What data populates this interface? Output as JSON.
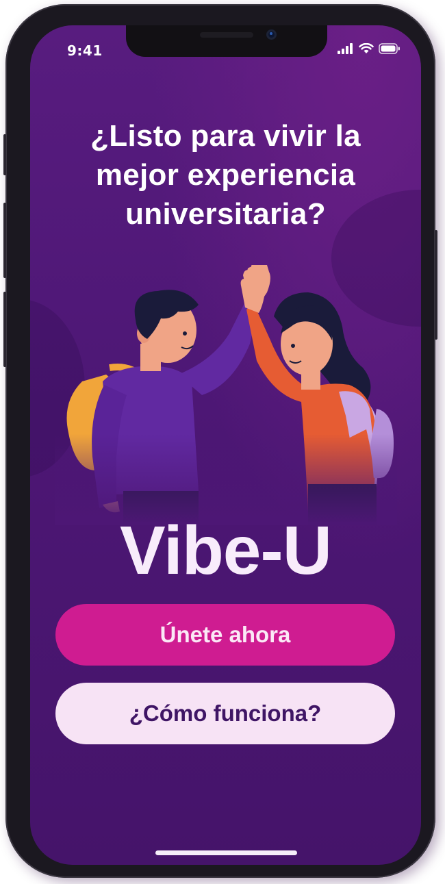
{
  "status_bar": {
    "time": "9:41",
    "icons": [
      "signal-icon",
      "wifi-icon",
      "battery-icon"
    ]
  },
  "onboarding": {
    "title": "¿Listo para vivir la mejor experiencia universitaria?",
    "illustration": "two-students-high-five",
    "brand": "Vibe-U",
    "primary_button": "Únete ahora",
    "secondary_button": "¿Cómo funciona?"
  },
  "colors": {
    "background": "#4d1775",
    "primary_button": "#cf1c91",
    "secondary_button": "#f7e3f5",
    "secondary_button_text": "#3f1565",
    "text": "#ffffff"
  }
}
